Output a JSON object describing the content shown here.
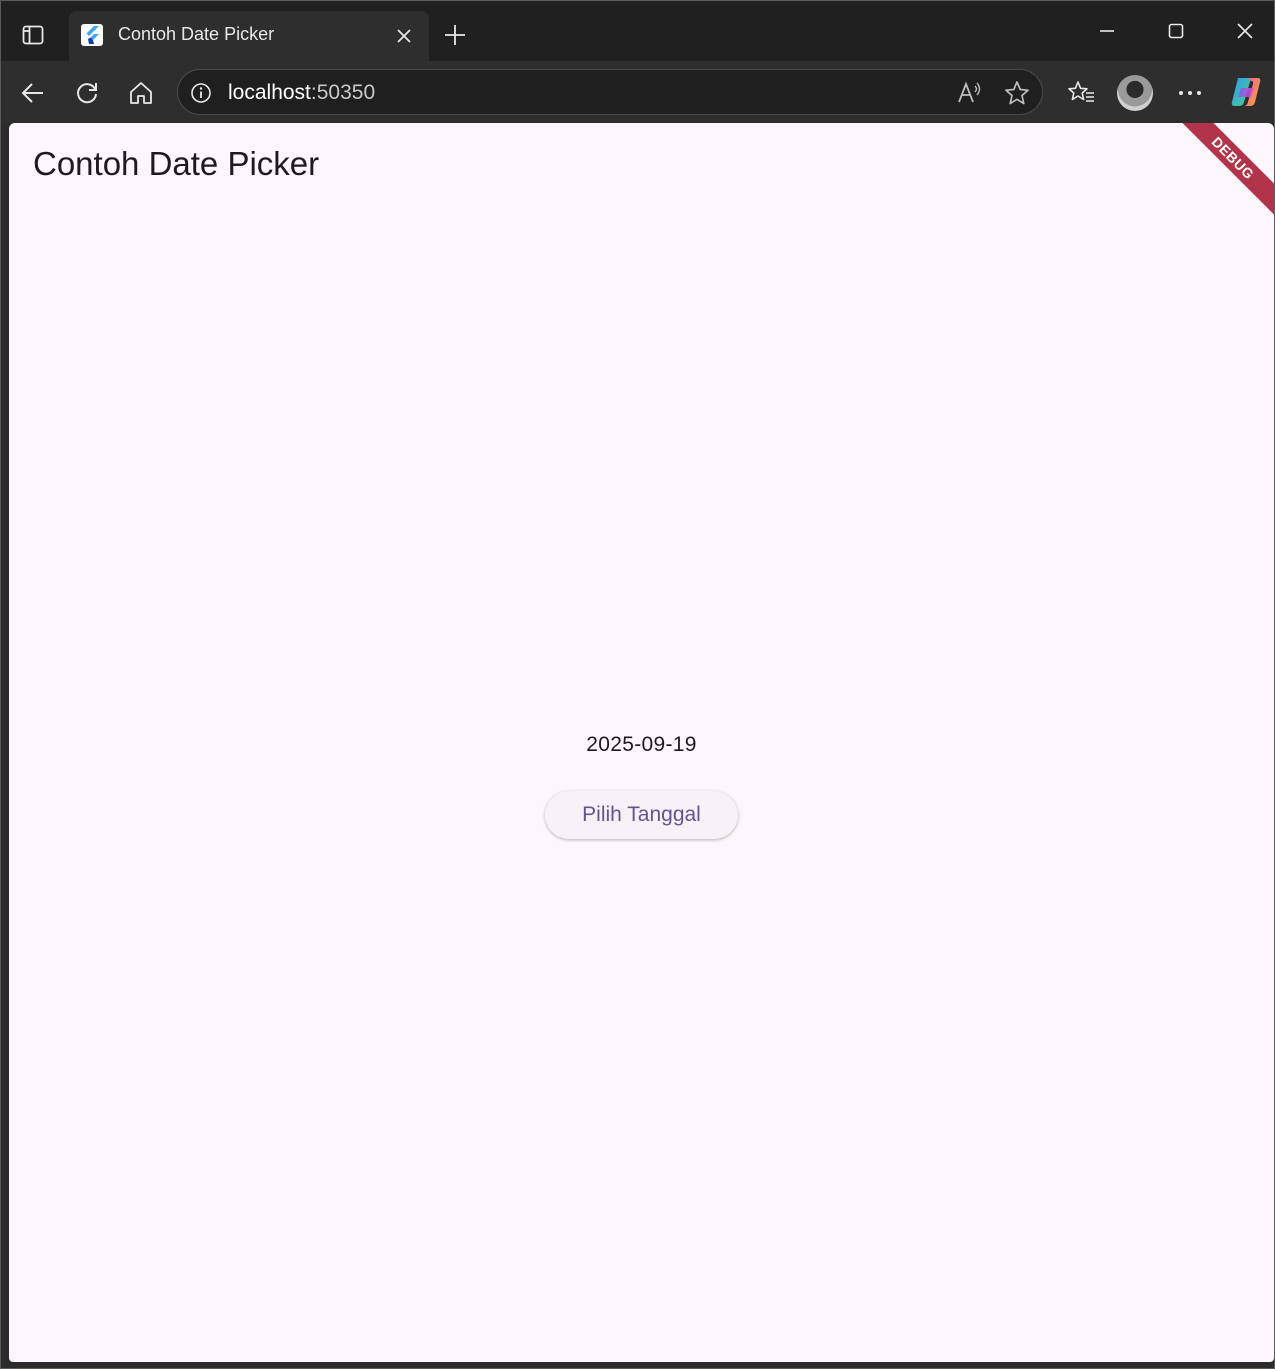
{
  "browser": {
    "tab": {
      "title": "Contoh Date Picker"
    },
    "address": {
      "host": "localhost",
      "port": ":50350"
    },
    "icons": {
      "tab_actions": "tab-actions-icon",
      "favicon": "flutter-icon",
      "close_tab": "close-icon",
      "new_tab": "plus-icon",
      "minimize": "minimize-icon",
      "maximize": "maximize-icon",
      "close_window": "close-icon",
      "back": "back-arrow-icon",
      "refresh": "refresh-icon",
      "home": "home-icon",
      "site_info": "info-icon",
      "read_aloud": "read-aloud-icon",
      "favorite": "star-icon",
      "favorites": "favorites-icon",
      "profile": "avatar",
      "more": "more-icon",
      "copilot": "copilot-icon"
    }
  },
  "app": {
    "title": "Contoh Date Picker",
    "selected_date": "2025-09-19",
    "button_label": "Pilih Tanggal",
    "debug_banner": "DEBUG",
    "colors": {
      "background": "#fdf6fc",
      "button_text": "#65558f",
      "banner": "#b1344a"
    }
  }
}
